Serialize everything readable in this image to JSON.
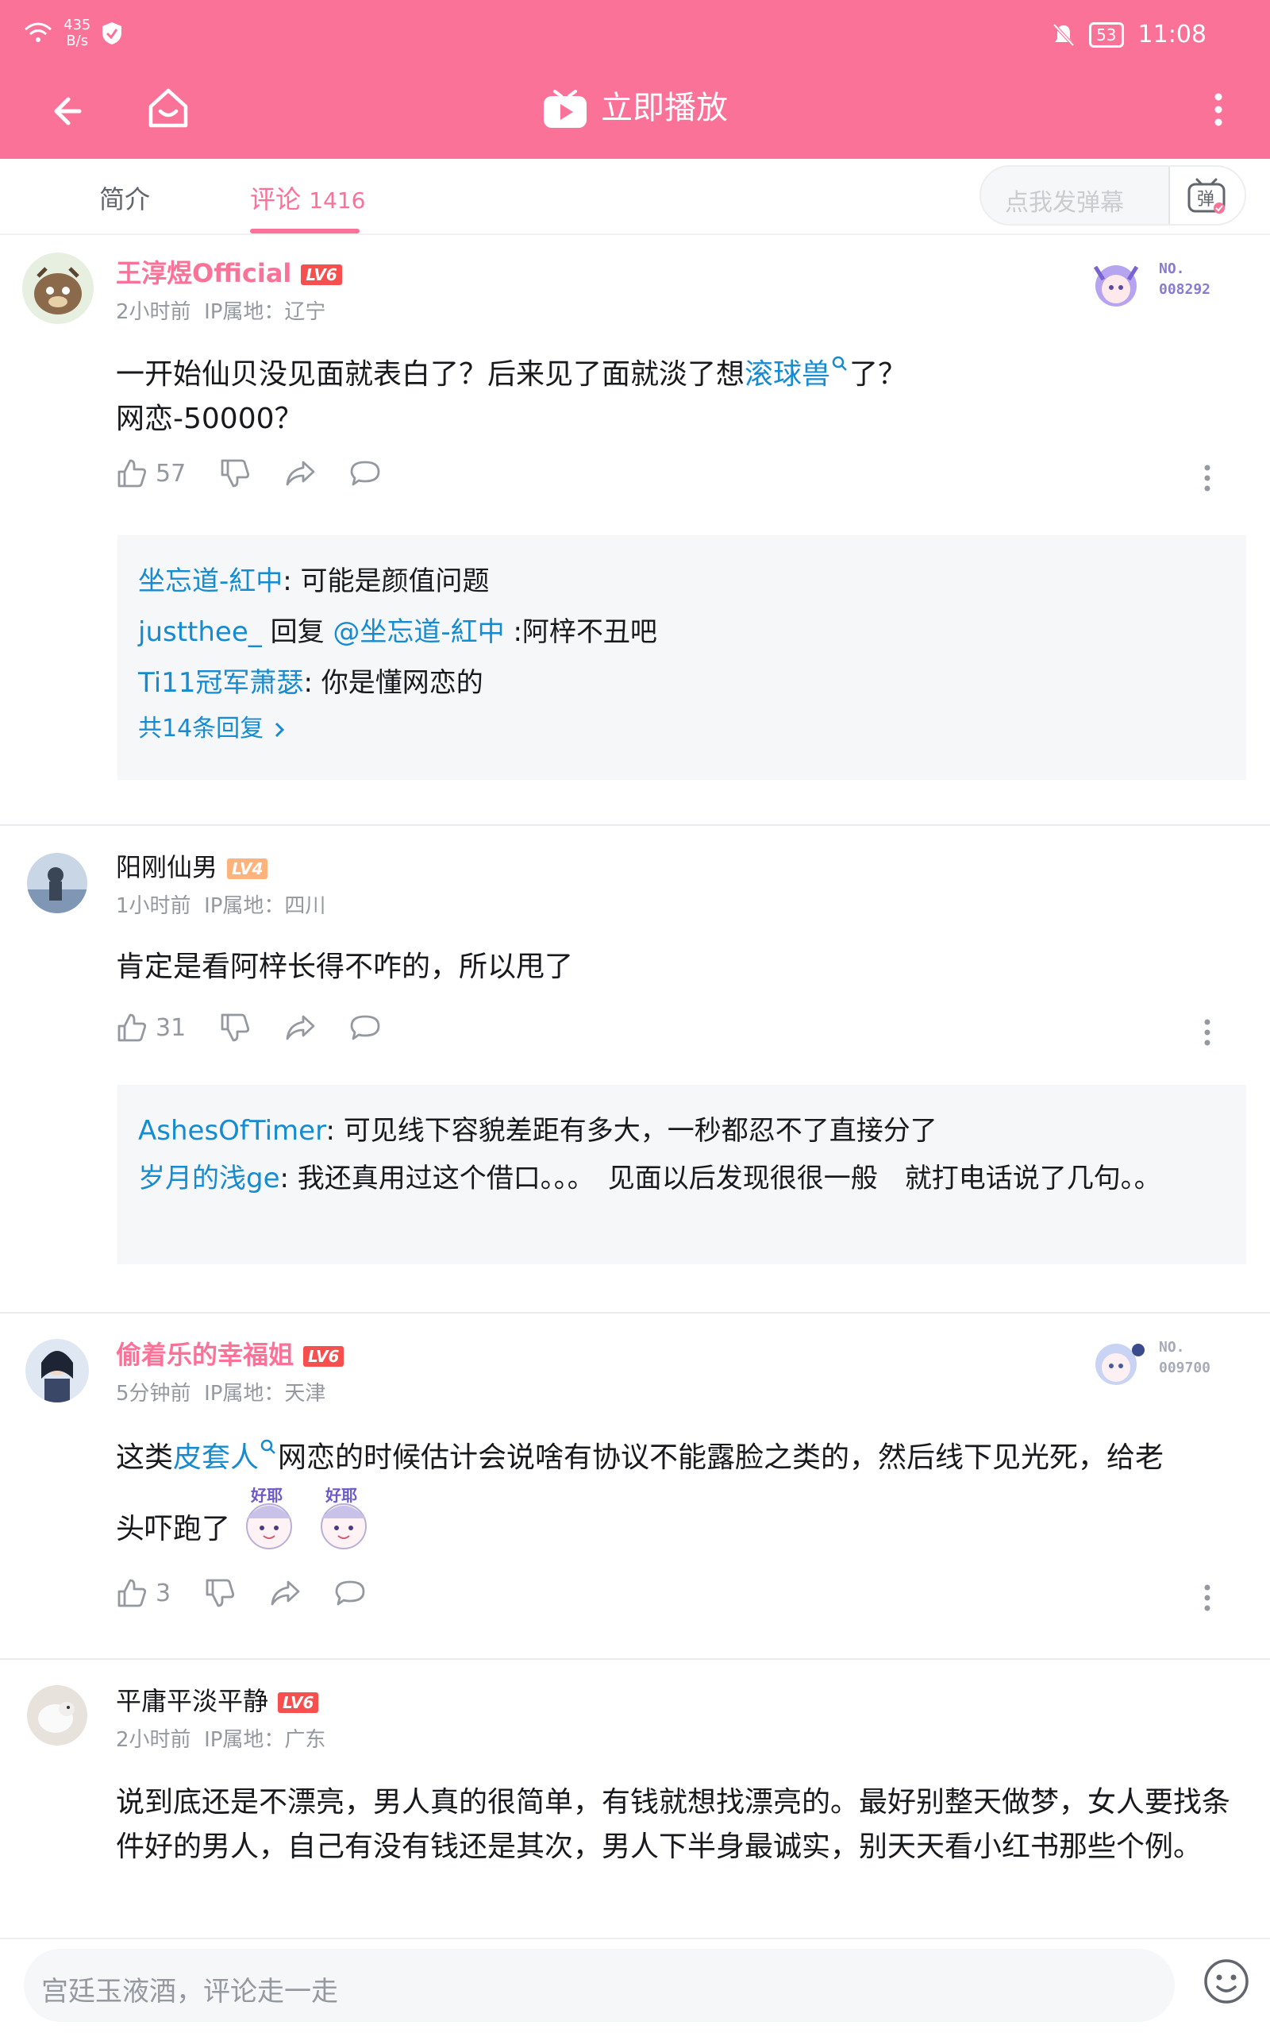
{
  "status_bar": {
    "net_speed_value": "435",
    "net_speed_unit": "B/s",
    "battery": "53",
    "time": "11:08"
  },
  "header": {
    "title": "立即播放"
  },
  "tabs": [
    {
      "label": "简介"
    },
    {
      "label": "评论",
      "count": "1416"
    }
  ],
  "danmu": {
    "placeholder": "点我发弹幕",
    "button_label": "弹"
  },
  "comments": [
    {
      "user": "王淳煜Official",
      "level": "LV6",
      "time": "2小时前",
      "ip": "IP属地：辽宁",
      "content_pre": "一开始仙贝没见面就表白了？后来见了面就淡了想",
      "content_link": "滚球兽",
      "content_post": "了？",
      "content_line2": "网恋-50000？",
      "likes": "57",
      "badge_no": "NO.",
      "badge_num": "008292",
      "replies": [
        {
          "name": "坐忘道-紅中",
          "text": ": 可能是颜值问题"
        },
        {
          "name": "justthee_",
          "text": " 回复 ",
          "mention": "@坐忘道-紅中",
          "text2": " :阿梓不丑吧"
        },
        {
          "name": "Ti11冠军萧瑟",
          "text": ": 你是懂网恋的"
        }
      ],
      "more_replies": "共14条回复"
    },
    {
      "user": "阳刚仙男",
      "level": "LV4",
      "time": "1小时前",
      "ip": "IP属地：四川",
      "content": "肯定是看阿梓长得不咋的，所以甩了",
      "likes": "31",
      "replies": [
        {
          "name": "AshesOfTimer",
          "text": ": 可见线下容貌差距有多大，一秒都忍不了直接分了"
        },
        {
          "name": "岁月的浅ge",
          "text": ": 我还真用过这个借口。。。　见面以后发现很很一般　就打电话说了几句。。"
        }
      ]
    },
    {
      "user": "偷着乐的幸福姐",
      "level": "LV6",
      "time": "5分钟前",
      "ip": "IP属地：天津",
      "content_pre": "这类",
      "content_link": "皮套人",
      "content_post": "网恋的时候估计会说啥有协议不能露脸之类的，然后线下见光死，给老",
      "content_line2": "头吓跑了",
      "likes": "3",
      "badge_no": "NO.",
      "badge_num": "009700",
      "sticker_text": "好耶"
    },
    {
      "user": "平庸平淡平静",
      "level": "LV6",
      "time": "2小时前",
      "ip": "IP属地：广东",
      "content": "说到底还是不漂亮，男人真的很简单，有钱就想找漂亮的。最好别整天做梦，女人要找条件好的男人，自己有没有钱还是其次，男人下半身最诚实，别天天看小红书那些个例。"
    }
  ],
  "input_bar": {
    "placeholder": "宫廷玉液酒，评论走一走"
  },
  "colors": {
    "brand_pink": "#fb7299",
    "link_blue": "#178bcf",
    "lv6_red": "#f74e4e",
    "lv4_orange": "#ffb37c"
  }
}
